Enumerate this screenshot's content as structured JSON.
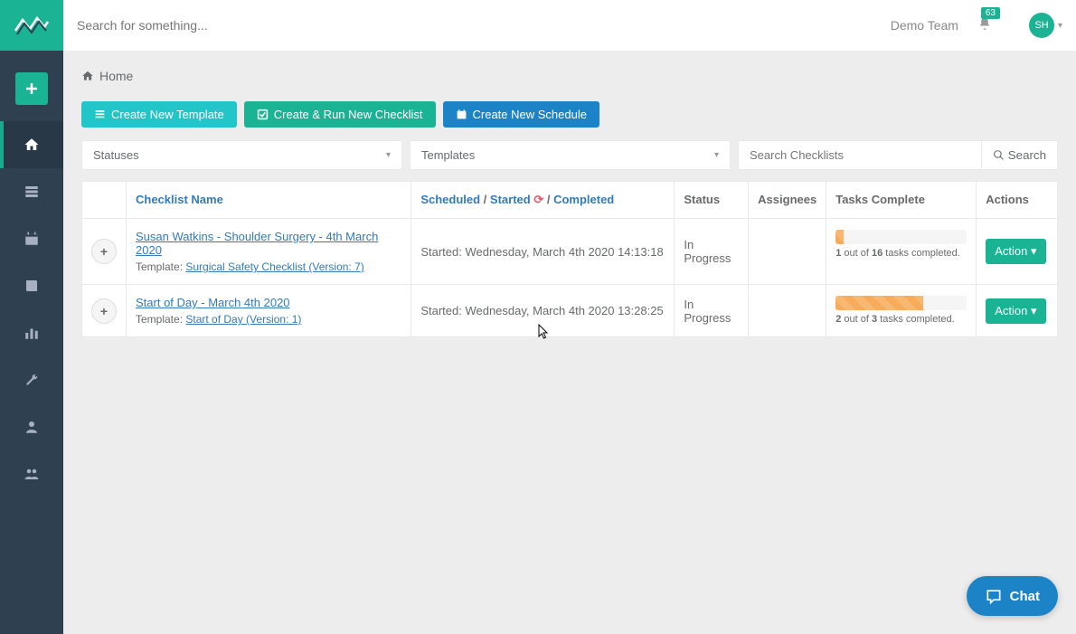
{
  "topbar": {
    "search_placeholder": "Search for something...",
    "team": "Demo Team",
    "notif_count": "63",
    "avatar_initials": "SH"
  },
  "breadcrumb": {
    "home": "Home"
  },
  "buttons": {
    "new_template": "Create New Template",
    "new_checklist": "Create & Run New Checklist",
    "new_schedule": "Create New Schedule"
  },
  "filters": {
    "statuses": "Statuses",
    "templates": "Templates",
    "search_placeholder": "Search Checklists",
    "search_btn": "Search"
  },
  "table": {
    "headers": {
      "name": "Checklist Name",
      "scheduled": "Scheduled",
      "started": "Started",
      "completed": "Completed",
      "status": "Status",
      "assignees": "Assignees",
      "tasks": "Tasks Complete",
      "actions": "Actions",
      "sep": " / "
    },
    "template_prefix": "Template: ",
    "action_label": "Action ",
    "rows": [
      {
        "name": "Susan Watkins - Shoulder Surgery - 4th March 2020",
        "template": "Surgical Safety Checklist (Version: 7)",
        "started": "Started: Wednesday, March 4th 2020 14:13:18",
        "status": "In Progress",
        "done": "1",
        "total": "16",
        "text_a": " out of ",
        "text_b": " tasks completed.",
        "pct": 6
      },
      {
        "name": "Start of Day - March 4th 2020",
        "template": "Start of Day (Version: 1)",
        "started": "Started: Wednesday, March 4th 2020 13:28:25",
        "status": "In Progress",
        "done": "2",
        "total": "3",
        "text_a": " out of ",
        "text_b": " tasks completed.",
        "pct": 67
      }
    ]
  },
  "chat": {
    "label": "Chat"
  }
}
